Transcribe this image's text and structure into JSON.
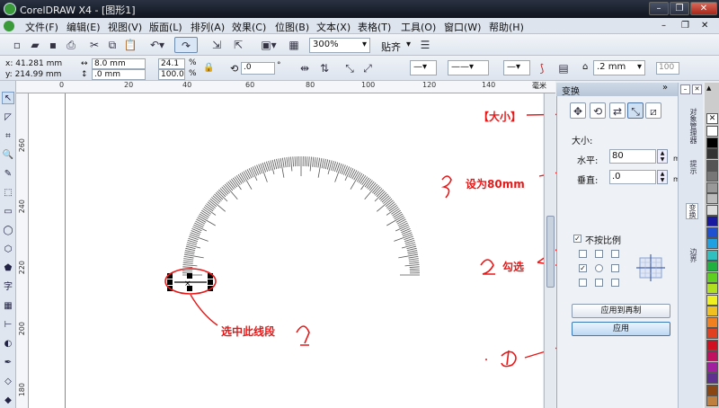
{
  "window": {
    "title": "CorelDRAW X4 - [图形1]"
  },
  "menu": [
    "文件(F)",
    "编辑(E)",
    "视图(V)",
    "版面(L)",
    "排列(A)",
    "效果(C)",
    "位图(B)",
    "文本(X)",
    "表格(T)",
    "工具(O)",
    "窗口(W)",
    "帮助(H)"
  ],
  "toolbar": {
    "zoom": "300%",
    "snap": "贴齐"
  },
  "propbar": {
    "x": "x: 41.281 mm",
    "y": "y: 214.99 mm",
    "w": "8.0 mm",
    "h": ".0 mm",
    "sx": "24.1",
    "sy": "100.0",
    "pct": "%",
    "angle": ".0",
    "deg": "°",
    "outline": ".2 mm",
    "scale": "100"
  },
  "ruler": {
    "h": [
      "0",
      "20",
      "40",
      "60",
      "80",
      "100",
      "120",
      "140"
    ],
    "v": [
      "260",
      "240",
      "220",
      "200",
      "180"
    ]
  },
  "docker": {
    "title": "变换",
    "size_heading": "大小:",
    "width_label": "水平:",
    "width_value": "80",
    "height_label": "垂直:",
    "height_value": ".0",
    "unit": "mm",
    "proportional_label": "不按比例",
    "apply_dup": "应用到再制",
    "apply": "应用"
  },
  "sidetabs": [
    "对象管理器",
    "提示",
    "变换",
    "边界"
  ],
  "annotations": {
    "size_tab": "【大小】",
    "step3": "设为80mm",
    "step2": "勾选",
    "step1": "选中此线段"
  },
  "palette": [
    "#ffffff",
    "#000000",
    "#333333",
    "#555555",
    "#777777",
    "#999999",
    "#bbbbbb",
    "#dddddd",
    "#1a1aa0",
    "#2050d0",
    "#20a0e0",
    "#30c0c0",
    "#20b040",
    "#60d020",
    "#b0e020",
    "#f0f020",
    "#f0c020",
    "#f08020",
    "#e04020",
    "#d01020",
    "#c01060",
    "#a020a0",
    "#603090",
    "#8b4513",
    "#c08040",
    "#e0c090",
    "#f0e0c0",
    "#ffe0e0",
    "#e0ffe0",
    "#e0e0ff"
  ]
}
